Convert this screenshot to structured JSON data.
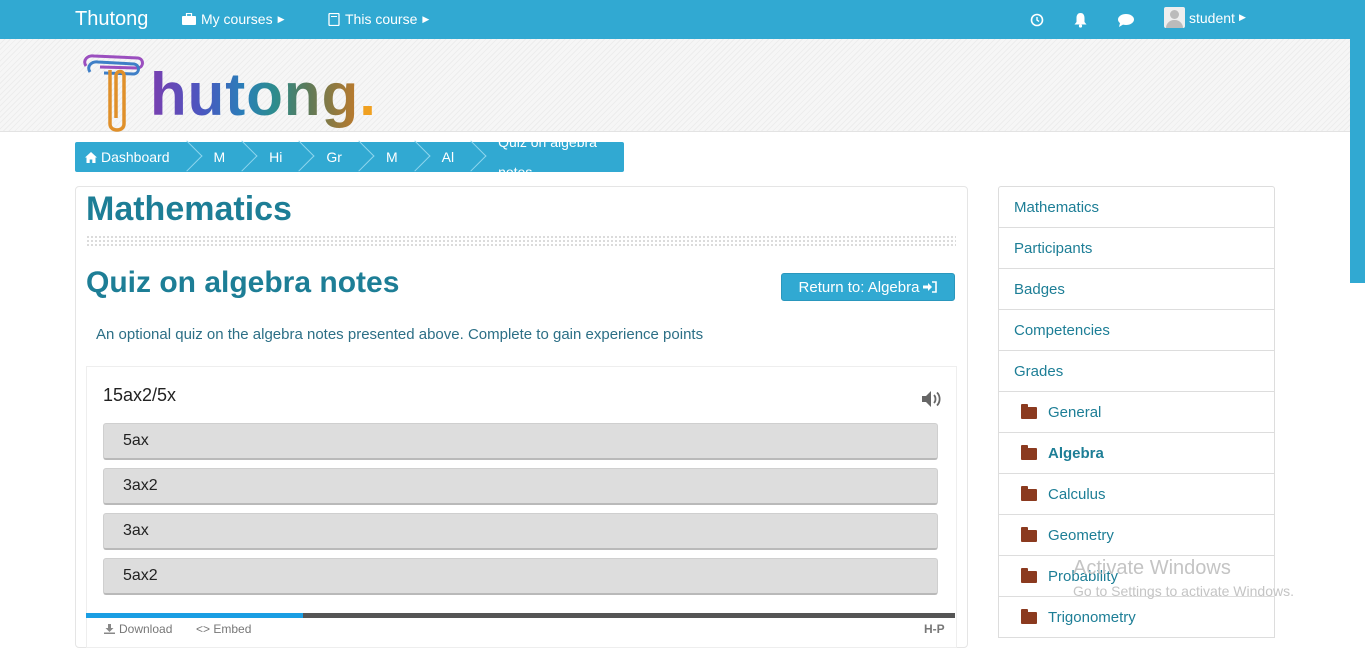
{
  "navbar": {
    "brand": "Thutong",
    "my_courses": "My courses",
    "this_course": "This course",
    "user": "student",
    "icons": [
      "history-icon",
      "bell-icon",
      "chat-icon"
    ]
  },
  "logo": {
    "text_first": "T",
    "text_rest": "hutong",
    "dot": "."
  },
  "breadcrumb": [
    "Dashboard",
    "M",
    "Hi",
    "Gr",
    "M",
    "Al",
    "Quiz on algebra notes"
  ],
  "page": {
    "course_title": "Mathematics",
    "activity_title": "Quiz on algebra notes",
    "return_button": "Return to: Algebra",
    "intro": "An optional quiz on the algebra notes presented above. Complete to gain experience points"
  },
  "quiz": {
    "question": "15ax2/5x",
    "answers": [
      "5ax",
      "3ax2",
      "3ax",
      "5ax2"
    ],
    "progress_fraction": 0.25,
    "footer_download": "Download",
    "footer_embed": "<> Embed",
    "footer_h5p": "H-P"
  },
  "nav": {
    "items": [
      "Mathematics",
      "Participants",
      "Badges",
      "Competencies",
      "Grades"
    ],
    "sections": [
      "General",
      "Algebra",
      "Calculus",
      "Geometry",
      "Probability",
      "Trigonometry"
    ],
    "active_section": "Algebra"
  },
  "watermark": {
    "line1": "Activate Windows",
    "line2": "Go to Settings to activate Windows."
  },
  "colors": {
    "brand_blue": "#31a9d2",
    "title_teal": "#1d7e96",
    "folder_brown": "#8b3a1f",
    "progress_blue": "#1a9ee3"
  }
}
